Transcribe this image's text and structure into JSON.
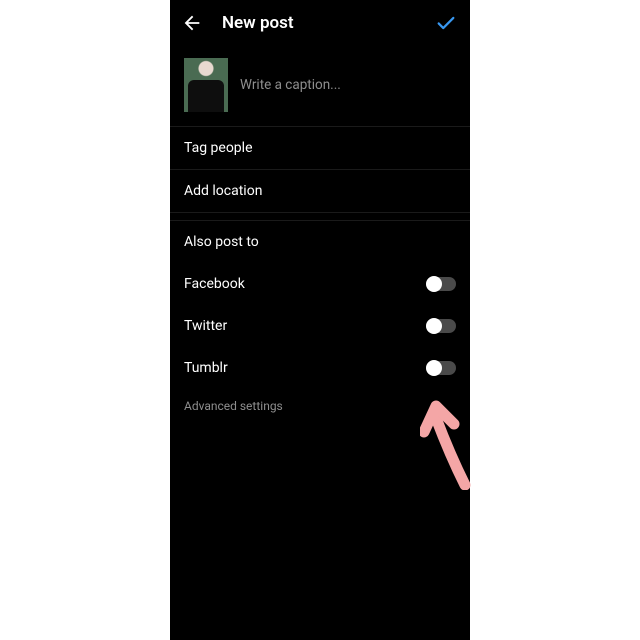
{
  "header": {
    "title": "New post",
    "back_icon": "arrow-left",
    "done_icon": "check",
    "accent_color": "#3897f0"
  },
  "caption": {
    "placeholder": "Write a caption..."
  },
  "rows": {
    "tag_people": "Tag people",
    "add_location": "Add location",
    "also_post_to": "Also post to"
  },
  "share_targets": [
    {
      "label": "Facebook",
      "on": false
    },
    {
      "label": "Twitter",
      "on": false
    },
    {
      "label": "Tumblr",
      "on": false
    }
  ],
  "advanced_settings": "Advanced settings",
  "annotation": {
    "type": "arrow",
    "color": "#f4a6a6",
    "points_to": "advanced-settings-link"
  }
}
